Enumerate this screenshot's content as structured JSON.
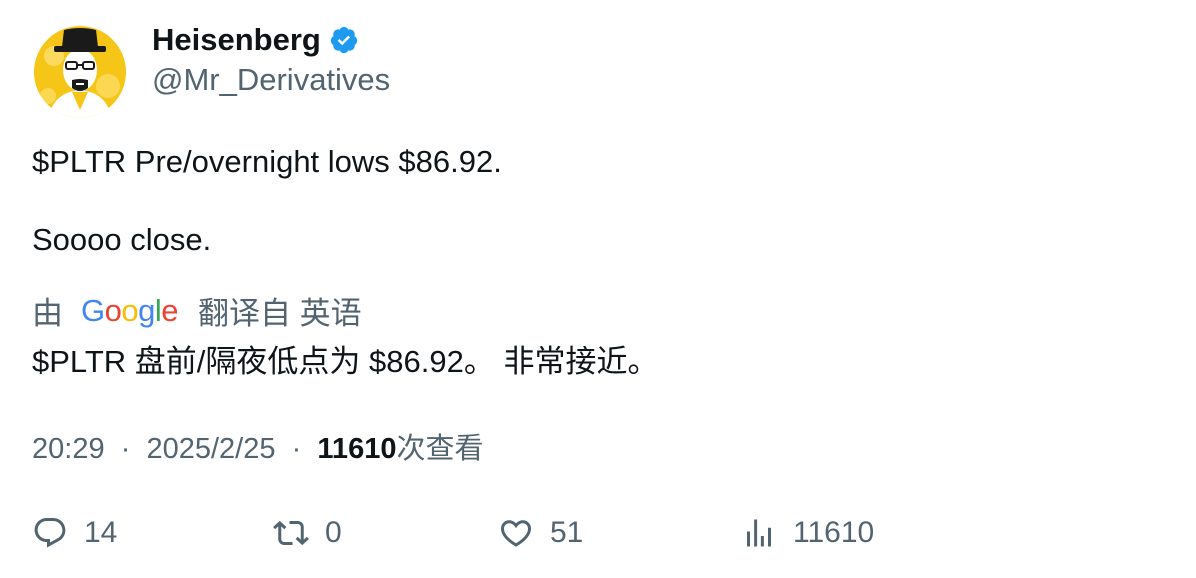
{
  "author": {
    "display_name": "Heisenberg",
    "handle": "@Mr_Derivatives",
    "verified": true,
    "avatar_icon": "heisenberg-avatar",
    "verified_color": "#1d9bf0"
  },
  "tweet": {
    "line1": "$PLTR Pre/overnight lows $86.92.",
    "line2": "Soooo close."
  },
  "translation": {
    "prefix": "由",
    "provider": "Google",
    "suffix": "翻译自 英语",
    "text": "$PLTR 盘前/隔夜低点为 $86.92。 非常接近。"
  },
  "meta": {
    "time": "20:29",
    "separator": "·",
    "date": "2025/2/25",
    "views_count": "11610",
    "views_label": "次查看"
  },
  "actions": {
    "replies": "14",
    "retweets": "0",
    "likes": "51",
    "views": "11610"
  },
  "colors": {
    "text_primary": "#0f1419",
    "text_secondary": "#536471",
    "avatar_bg": "#f5c518"
  }
}
